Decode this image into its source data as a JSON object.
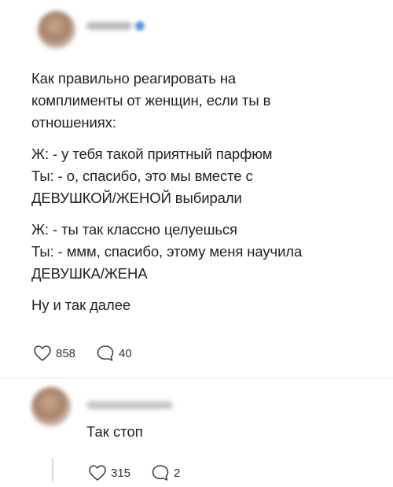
{
  "post": {
    "paragraphs": [
      [
        "Как правильно реагировать на",
        "комплименты от женщин, если ты в",
        "отношениях:"
      ],
      [
        "Ж: - у тебя такой приятный парфюм",
        "Ты: - о, спасибо, это мы вместе с",
        "ДЕВУШКОЙ/ЖЕНОЙ выбирали"
      ],
      [
        "Ж: - ты так классно целуешься",
        "Ты: - ммм, спасибо, этому меня научила",
        "ДЕВУШКА/ЖЕНА"
      ],
      [
        "Ну и так далее"
      ]
    ],
    "likes": "858",
    "comments": "40"
  },
  "reply": {
    "text": "Так стоп",
    "likes": "315",
    "comments": "2"
  },
  "icons": [
    "heart-icon",
    "comment-icon"
  ],
  "colors": {
    "text": "#222222",
    "icon_stroke": "#444444",
    "verified": "#5b93e8"
  }
}
